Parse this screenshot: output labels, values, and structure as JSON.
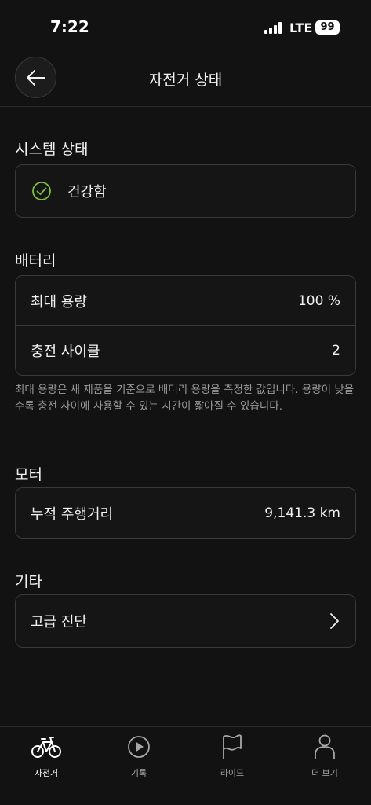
{
  "status_bar": {
    "time": "7:22",
    "network": "LTE",
    "battery": "99"
  },
  "header": {
    "title": "자전거 상태",
    "back_icon": "arrow-left-icon"
  },
  "system": {
    "title": "시스템 상태",
    "status": "건강함",
    "status_icon": "check-circle-icon",
    "status_color": "#7bc043"
  },
  "battery": {
    "title": "배터리",
    "rows": [
      {
        "label": "최대 용량",
        "value": "100 %"
      },
      {
        "label": "충전 사이클",
        "value": "2"
      }
    ],
    "note": "최대 용량은 새 제품을 기준으로 배터리 용량을 측정한 값입니다. 용량이 낮을수록 충전 사이에 사용할 수 있는 시간이 짧아질 수 있습니다."
  },
  "motor": {
    "title": "모터",
    "rows": [
      {
        "label": "누적 주행거리",
        "value": "9,141.3 km"
      }
    ]
  },
  "other": {
    "title": "기타",
    "rows": [
      {
        "label": "고급 진단",
        "icon": "chevron-right-icon"
      }
    ]
  },
  "tabs": [
    {
      "label": "자전거",
      "icon": "bicycle-icon",
      "active": true
    },
    {
      "label": "기록",
      "icon": "play-circle-icon",
      "active": false
    },
    {
      "label": "라이드",
      "icon": "flag-icon",
      "active": false
    },
    {
      "label": "더 보기",
      "icon": "person-icon",
      "active": false
    }
  ]
}
